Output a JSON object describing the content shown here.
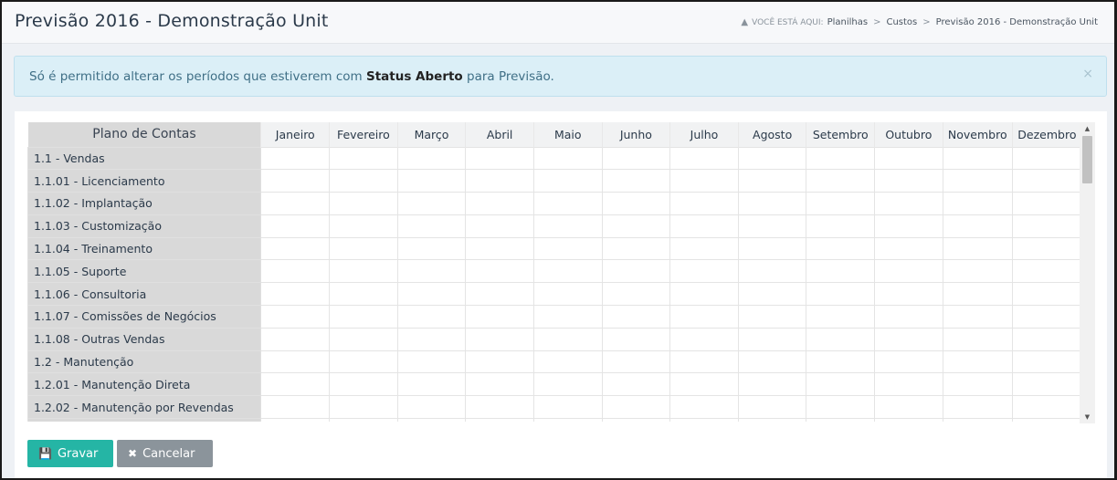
{
  "header": {
    "title": "Previsão 2016 - Demonstração Unit",
    "breadcrumb": {
      "prefix": "VOCÊ ESTÁ AQUI:",
      "icon": "sitemap-icon",
      "items": [
        "Planilhas",
        "Custos",
        "Previsão 2016 - Demonstração Unit"
      ],
      "separator": ">"
    }
  },
  "alert": {
    "text_before": "Só é permitido alterar os períodos que estiverem com ",
    "text_bold": "Status Aberto",
    "text_after": " para Previsão.",
    "close_label": "×"
  },
  "grid": {
    "account_header": "Plano de Contas",
    "months": [
      "Janeiro",
      "Fevereiro",
      "Março",
      "Abril",
      "Maio",
      "Junho",
      "Julho",
      "Agosto",
      "Setembro",
      "Outubro",
      "Novembro",
      "Dezembro"
    ],
    "rows": [
      "1.1 - Vendas",
      "1.1.01 - Licenciamento",
      "1.1.02 - Implantação",
      "1.1.03 - Customização",
      "1.1.04 - Treinamento",
      "1.1.05 - Suporte",
      "1.1.06 - Consultoria",
      "1.1.07 - Comissões de Negócios",
      "1.1.08 - Outras Vendas",
      "1.2 - Manutenção",
      "1.2.01 - Manutenção Direta",
      "1.2.02 - Manutenção por Revendas",
      ""
    ]
  },
  "scrollbar": {
    "up_label": "▲",
    "down_label": "▼"
  },
  "buttons": {
    "save_label": "Gravar",
    "save_icon": "floppy-disk-icon",
    "cancel_label": "Cancelar",
    "cancel_icon": "close-icon"
  },
  "colors": {
    "alert_bg": "#dbeff7",
    "save_button": "#25b5a5",
    "cancel_button": "#8b949b",
    "account_column": "#d9d9d9"
  }
}
